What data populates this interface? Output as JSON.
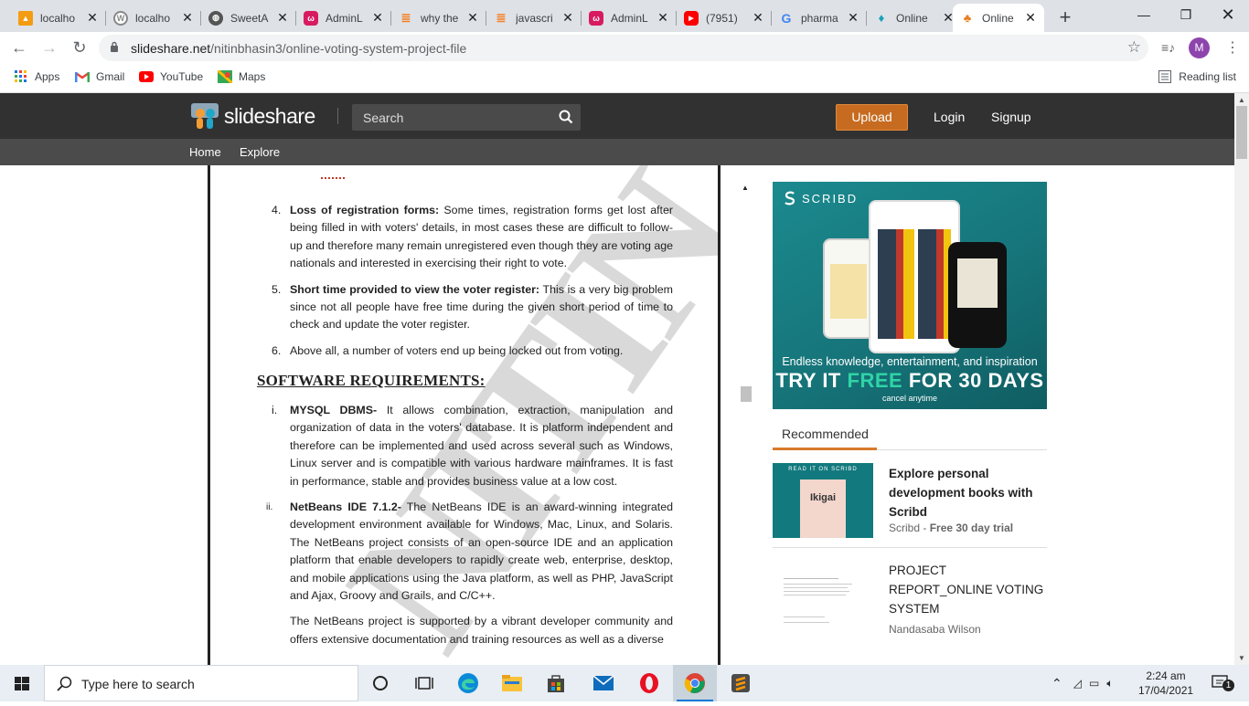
{
  "browser": {
    "tabs": [
      {
        "title": "localho",
        "icon": "pma-icon",
        "color": "#e67e22"
      },
      {
        "title": "localho",
        "icon": "webui-icon",
        "color": "#8a8a8a"
      },
      {
        "title": "SweetA",
        "icon": "globe-icon",
        "color": "#444"
      },
      {
        "title": "AdminL",
        "icon": "adminlte-icon",
        "color": "#c2185b"
      },
      {
        "title": "why the",
        "icon": "stackoverflow-icon",
        "color": "#f48024"
      },
      {
        "title": "javascri",
        "icon": "stackoverflow-icon",
        "color": "#f48024"
      },
      {
        "title": "AdminL",
        "icon": "adminlte-icon",
        "color": "#c2185b"
      },
      {
        "title": "(7951)",
        "icon": "youtube-icon",
        "color": "#ff0000"
      },
      {
        "title": "pharma",
        "icon": "google-icon",
        "color": "#4285f4"
      },
      {
        "title": "Online",
        "icon": "slideshare-icon",
        "color": "#0aa"
      },
      {
        "title": "Online",
        "icon": "slideshare-icon",
        "color": "#0aa",
        "active": true
      }
    ],
    "url_host": "slideshare.net",
    "url_path": "/nitinbhasin3/online-voting-system-project-file",
    "profile_initial": "M",
    "bookmarks": {
      "apps": "Apps",
      "gmail": "Gmail",
      "youtube": "YouTube",
      "maps": "Maps",
      "reading_list": "Reading list"
    }
  },
  "slideshare": {
    "logo": "slideshare",
    "search_placeholder": "Search",
    "upload": "Upload",
    "login": "Login",
    "signup": "Signup",
    "subnav": {
      "home": "Home",
      "explore": "Explore"
    }
  },
  "document": {
    "items": [
      {
        "num": "4.",
        "bold": "Loss of registration forms:",
        "text": " Some times, registration forms get lost after being filled in with voters' details, in most cases these are difficult to follow-up and therefore many remain unregistered even though they are voting age nationals and interested in exercising their right to vote."
      },
      {
        "num": "5.",
        "bold": "Short time provided to view the voter register:",
        "text": " This is a very big problem since not all people have free time during the given short period of time to check and update the voter register."
      },
      {
        "num": "6.",
        "bold": "",
        "text": "Above all, a number of voters end up being locked out from voting."
      }
    ],
    "heading": "SOFTWARE REQUIREMENTS:",
    "req_items": [
      {
        "num": "i.",
        "bold": "MYSQL DBMS-",
        "text": " It allows combination, extraction, manipulation and organization of data in the voters' database. It is platform independent and therefore can be implemented and used across several such as Windows, Linux server and is compatible with various hardware mainframes. It is fast in performance, stable and provides business value at a low cost."
      },
      {
        "num": "ii.",
        "bold": "NetBeans IDE 7.1.2-",
        "text": " The NetBeans IDE is an award-winning integrated development environment available for Windows, Mac, Linux, and Solaris. The NetBeans project consists of an open-source IDE and an application platform that enable developers to rapidly create web, enterprise, desktop, and mobile applications using the Java platform, as well as PHP, JavaScript and Ajax, Groovy and Grails, and C/C++."
      }
    ],
    "paragraph": "The NetBeans project is supported by a vibrant developer community and offers extensive documentation and training resources as well as a diverse",
    "watermark": "NITIN"
  },
  "ad": {
    "brand": "SCRIBD",
    "tagline": "Endless knowledge, entertainment, and inspiration",
    "cta_try": "TRY IT",
    "cta_free": "FREE",
    "cta_rest": "FOR 30 DAYS",
    "cancel": "cancel anytime"
  },
  "recommended": {
    "header": "Recommended",
    "items": [
      {
        "title": "Explore personal development books with Scribd",
        "sub_prefix": "Scribd - ",
        "sub_bold": "Free 30 day trial",
        "thumb_label": "Ikigai",
        "thumb_brand": "READ IT ON SCRIBD"
      },
      {
        "title": "PROJECT REPORT_ONLINE VOTING SYSTEM",
        "author": "Nandasaba Wilson"
      }
    ]
  },
  "taskbar": {
    "search_placeholder": "Type here to search",
    "time": "2:24 am",
    "date": "17/04/2021",
    "notifications": "1"
  }
}
